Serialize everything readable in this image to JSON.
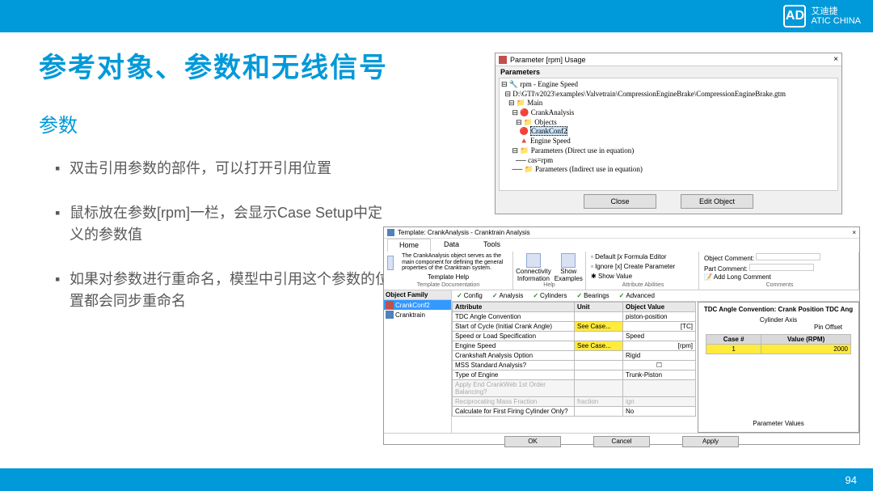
{
  "brand": {
    "name1": "艾迪捷",
    "name2": "ATIC CHINA",
    "logo": "AD"
  },
  "title": "参考对象、参数和无线信号",
  "subtitle": "参数",
  "bullets": [
    "双击引用参数的部件，可以打开引用位置",
    "鼠标放在参数[rpm]一栏，会显示Case Setup中定义的参数值",
    "如果对参数进行重命名，模型中引用这个参数的位置都会同步重命名"
  ],
  "page_number": "94",
  "dlg1": {
    "title": "Parameter [rpm] Usage",
    "section": "Parameters",
    "tree": {
      "root": "rpm - Engine Speed",
      "path": "D:\\GTI\\v2023\\examples\\Valvetrain\\CompressionEngineBrake\\CompressionEngineBrake.gtm",
      "main": "Main",
      "crank": "CrankAnalysis",
      "objects": "Objects",
      "crankconf": "CrankConf2",
      "enginespeed": "Engine Speed",
      "params_direct": "Parameters (Direct use in equation)",
      "casrpm": "cas=rpm",
      "params_indirect": "Parameters (Indirect use in equation)"
    },
    "buttons": {
      "close": "Close",
      "edit": "Edit Object"
    }
  },
  "dlg2": {
    "title": "Template: CrankAnalysis - Cranktrain Analysis",
    "menutabs": [
      "Home",
      "Data",
      "Tools"
    ],
    "desc": "The CrankAnalysis object serves as the main component for defining the general properties of the Cranktrain system.",
    "template_help": "Template Help",
    "groups": {
      "doc": "Template Documentation",
      "help": "Help",
      "attr": "Attribute Abilities",
      "comments": "Comments"
    },
    "ribbon_items": {
      "conn": "Connectivity Information",
      "show": "Show Examples",
      "default": "Default",
      "ignore": "Ignore",
      "showval": "Show Value",
      "formula": "Formula Editor",
      "create": "Create Parameter",
      "objc": "Object Comment:",
      "partc": "Part Comment:",
      "addlong": "Add Long Comment"
    },
    "leftpane": {
      "hdr": "Object Family",
      "items": [
        "CrankConf2",
        "Cranktrain"
      ]
    },
    "filtabs": [
      "Config",
      "Analysis",
      "Cylinders",
      "Bearings",
      "Advanced"
    ],
    "grid_headers": {
      "attr": "Attribute",
      "unit": "Unit",
      "val": "Object Value"
    },
    "rows": [
      {
        "attr": "TDC Angle Convention",
        "unit": "",
        "val": "piston-position"
      },
      {
        "attr": "Start of Cycle (Initial Crank Angle)",
        "unit": "See Case...",
        "val": "[TC]"
      },
      {
        "attr": "Speed or Load Specification",
        "unit": "",
        "val": "Speed"
      },
      {
        "attr": "Engine Speed",
        "unit": "See Case...",
        "val": "[rpm]"
      },
      {
        "attr": "Crankshaft Analysis Option",
        "unit": "",
        "val": "Rigid"
      },
      {
        "attr": "MSS Standard Analysis?",
        "unit": "",
        "val": "☐"
      },
      {
        "attr": "Type of Engine",
        "unit": "",
        "val": "Trunk-Piston"
      },
      {
        "attr": "Apply End CrankWeb 1st Order Balancing?",
        "unit": "",
        "val": "",
        "dis": true
      },
      {
        "attr": "  Reciprocating Mass Fraction",
        "unit": "fraction",
        "val": "ign",
        "dis": true
      },
      {
        "attr": "Calculate for First Firing Cylinder Only?",
        "unit": "",
        "val": "No"
      }
    ],
    "popup": {
      "hdr": "TDC Angle Convention: Crank Position     TDC Ang",
      "axis": "Cylinder Axis",
      "pin": "Pin Offset",
      "caseh": "Case #",
      "valh": "Value (RPM)",
      "case": "1",
      "val": "2000",
      "pv": "Parameter Values"
    },
    "buttons": {
      "ok": "OK",
      "cancel": "Cancel",
      "apply": "Apply"
    }
  }
}
